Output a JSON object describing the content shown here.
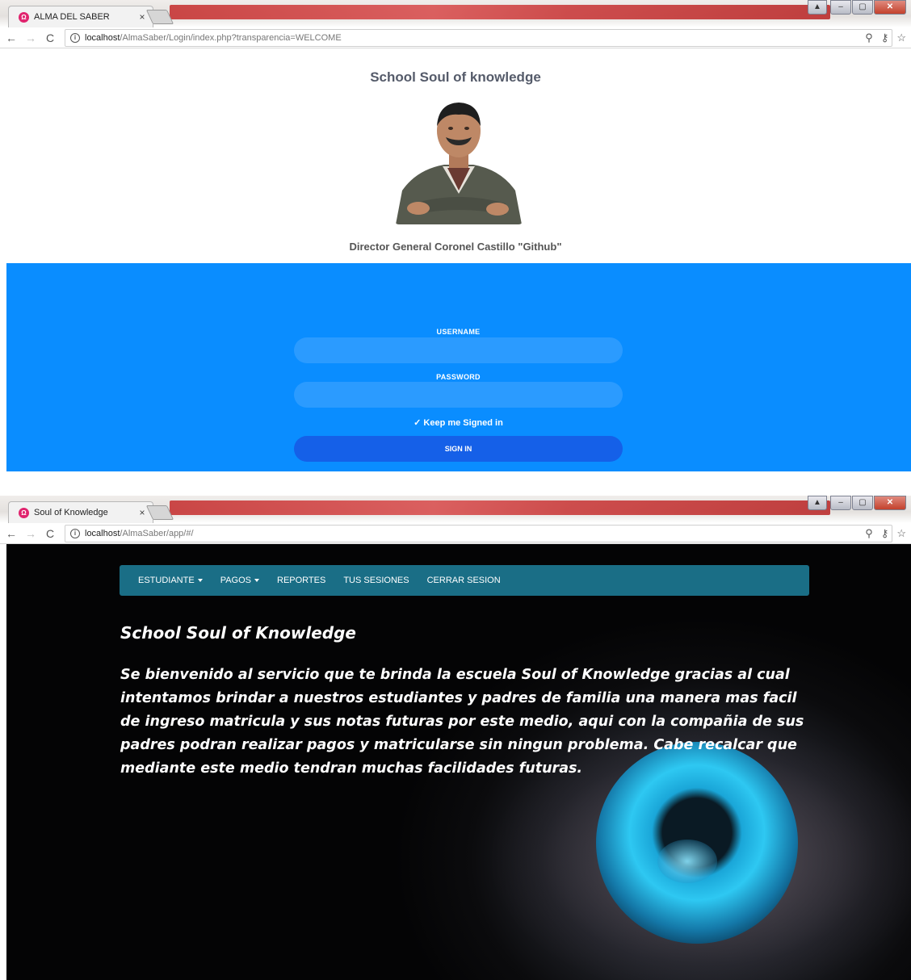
{
  "login_window": {
    "tab_title": "ALMA DEL SABER",
    "favicon_glyph": "Ω",
    "tab_close": "×",
    "url_host": "localhost",
    "url_path": "/AlmaSaber/Login/index.php?transparencia=WELCOME",
    "school_title": "School Soul of knowledge",
    "director_caption": "Director General Coronel Castillo \"Github\"",
    "username_label": "USERNAME",
    "password_label": "PASSWORD",
    "keep_signed_label": "Keep me Signed in",
    "signin_label": "SIGN IN"
  },
  "app_window": {
    "tab_title": "Soul of Knowledge",
    "favicon_glyph": "Ω",
    "tab_close": "×",
    "url_host": "localhost",
    "url_path": "/AlmaSaber/app/#/",
    "nav": {
      "estudiante": "ESTUDIANTE",
      "pagos": "PAGOS",
      "reportes": "REPORTES",
      "sesiones": "TUS SESIONES",
      "cerrar": "CERRAR SESION"
    },
    "title": "School Soul of Knowledge",
    "body": "Se bienvenido al servicio que te brinda la escuela Soul of Knowledge gracias al cual intentamos brindar a nuestros estudiantes y padres de familia una manera mas facil de ingreso matricula y sus notas futuras por este medio, aqui con la compañia de sus padres podran realizar pagos y matricularse sin ningun problema. Cabe recalcar que mediante este medio tendran muchas facilidades futuras."
  },
  "icons": {
    "back": "←",
    "forward": "→",
    "reload": "C",
    "info": "i",
    "zoom": "⚲",
    "key": "⚷",
    "star": "☆",
    "check": "✓"
  },
  "colors": {
    "login_panel": "#0a8dff",
    "input_bg": "#2b9bff",
    "signin_button": "#1560e8",
    "navbar": "#1a6e86",
    "favicon": "#e0246e"
  }
}
